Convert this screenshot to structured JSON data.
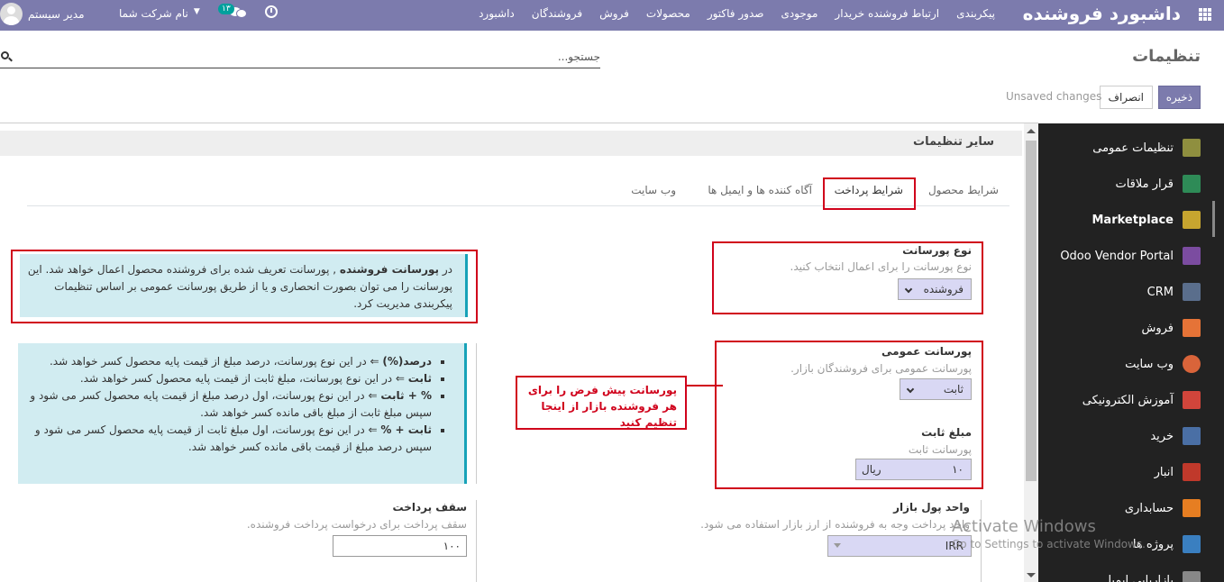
{
  "topbar": {
    "brand": "داشبورد فروشنده",
    "menu": [
      "داشبورد",
      "فروشندگان",
      "فروش",
      "محصولات",
      "صدور فاکتور",
      "موجودی",
      "ارتباط فروشنده خریدار",
      "پیکربندی"
    ],
    "chat_badge": "۱۳",
    "company": "نام شرکت شما",
    "user": "مدیر سیستم",
    "colors": {
      "bar": "#7c7bad",
      "badge": "#00a09d"
    }
  },
  "control_panel": {
    "title": "تنظیمات",
    "search_placeholder": "جستجو...",
    "save_label": "ذخیره",
    "cancel_label": "انصراف",
    "unsaved_text": "Unsaved changes"
  },
  "section": {
    "title": "سایر تنظیمات",
    "tabs": [
      "شرایط محصول",
      "شرایط پرداخت",
      "آگاه کننده ها و ایمیل ها",
      "وب سایت"
    ],
    "active_tab": "شرایط پرداخت"
  },
  "commission_type": {
    "label": "نوع پورسانت",
    "help": "نوع پورسانت را برای اعمال انتخاب کنید.",
    "value": "فروشنده"
  },
  "commission_info": {
    "prefix": "در ",
    "bold": "پورسانت فروشنده",
    "text": " , پورسانت تعریف شده برای فروشنده محصول اعمال خواهد شد. این پورسانت را می توان بصورت انحصاری و یا از طریق پورسانت عمومی بر اساس تنظیمات پیکربندی مدیریت کرد."
  },
  "global_commission": {
    "label": "پورسانت عمومی",
    "help": "پورسانت عمومی برای فروشندگان بازار.",
    "value": "ثابت"
  },
  "fixed_amount": {
    "label": "مبلغ ثابت",
    "help": "پورسانت ثابت",
    "value": "۱۰",
    "currency": "ریال"
  },
  "commission_types_info": [
    {
      "bold": "درصد(%)",
      "text": " ⇐ در این نوع پورسانت، درصد مبلغ از قیمت پایه محصول کسر خواهد شد."
    },
    {
      "bold": "ثابت",
      "text": " ⇐ در این نوع پورسانت، مبلغ ثابت از قیمت پایه محصول کسر خواهد شد."
    },
    {
      "bold": "% + ثابت",
      "text": " ⇐ در این نوع پورسانت، اول درصد مبلغ از قیمت پایه محصول کسر می شود و سپس مبلغ ثابت از مبلغ باقی مانده کسر خواهد شد."
    },
    {
      "bold": "ثابت + %",
      "text": " ⇐ در این نوع پورسانت، اول مبلغ ثابت از قیمت پایه محصول کسر می شود و سپس درصد مبلغ از قیمت باقی مانده کسر خواهد شد."
    }
  ],
  "annotation": "پورسانت پیش فرض را برای هر فروشنده بازار از اینجا تنظیم کنید",
  "marketplace_currency": {
    "label": "واحد پول بازار",
    "help": "واحد پرداخت وجه به فروشنده از ارز بازار استفاده می شود.",
    "value": "IRR"
  },
  "payment_limit": {
    "label": "سقف پرداخت",
    "help": "سقف پرداخت برای درخواست پرداخت فروشنده.",
    "value": "۱۰۰"
  },
  "sidebar": {
    "items": [
      {
        "label": "تنظیمات عمومی",
        "icon": "gear-icon",
        "color": "#8f8f3f"
      },
      {
        "label": "قرار ملاقات",
        "icon": "calendar-icon",
        "color": "#2e8b57"
      },
      {
        "label": "Marketplace",
        "icon": "store-icon",
        "color": "#c7a52f",
        "active": true
      },
      {
        "label": "Odoo Vendor Portal",
        "icon": "portal-icon",
        "color": "#7b4ca0"
      },
      {
        "label": "CRM",
        "icon": "handshake-icon",
        "color": "#5a6e8c"
      },
      {
        "label": "فروش",
        "icon": "chart-icon",
        "color": "#e57337"
      },
      {
        "label": "وب سایت",
        "icon": "globe-icon",
        "color": "#d9643a"
      },
      {
        "label": "آموزش الکترونیکی",
        "icon": "elearning-icon",
        "color": "#d1453b"
      },
      {
        "label": "خرید",
        "icon": "purchase-icon",
        "color": "#4a6fa5"
      },
      {
        "label": "انبار",
        "icon": "box-icon",
        "color": "#c0392b"
      },
      {
        "label": "حسابداری",
        "icon": "invoice-icon",
        "color": "#e67e22"
      },
      {
        "label": "پروژه ها",
        "icon": "puzzle-icon",
        "color": "#3a7fc0"
      },
      {
        "label": "بازاریابی ایمیل",
        "icon": "mail-icon",
        "color": "#888888"
      }
    ]
  },
  "watermark": {
    "line1": "Activate Windows",
    "line2": "Go to Settings to activate Windows."
  }
}
